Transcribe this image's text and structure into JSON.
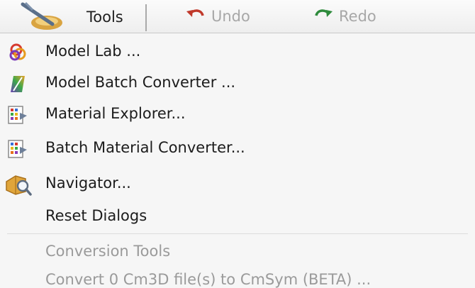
{
  "toolbar": {
    "tools_label": "Tools",
    "tools_icon": "tools-wrench-icon",
    "undo_label": "Undo",
    "undo_icon": "undo-arrow-icon",
    "redo_label": "Redo",
    "redo_icon": "redo-arrow-icon",
    "colors": {
      "undo_arrow": "#c0392b",
      "redo_arrow": "#2e8b3c",
      "disabled_text": "#a7a7a7"
    }
  },
  "menu": {
    "items": [
      {
        "label": "Model Lab ...",
        "icon": "model-lab-icon"
      },
      {
        "label": "Model Batch Converter ...",
        "icon": "batch-converter-icon"
      },
      {
        "label": "Material Explorer...",
        "icon": "material-explorer-icon"
      },
      {
        "label": "Batch Material Converter...",
        "icon": "batch-material-icon"
      },
      {
        "label": "Navigator...",
        "icon": "navigator-icon"
      },
      {
        "label": "Reset Dialogs",
        "icon": ""
      }
    ],
    "section_label": "Conversion Tools",
    "convert_label": "Convert 0 Cm3D file(s) to CmSym (BETA) ..."
  }
}
